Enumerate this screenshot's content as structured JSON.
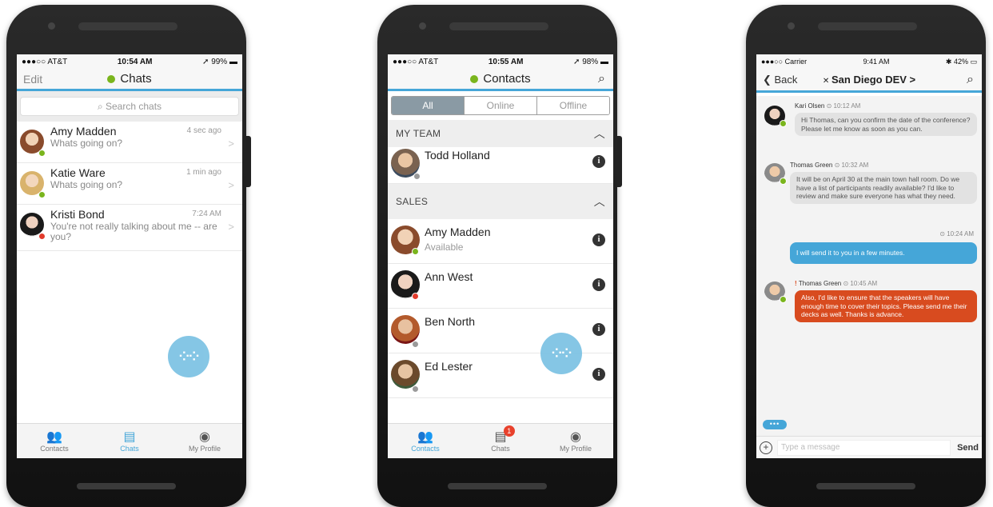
{
  "colors": {
    "accent": "#45a6d8",
    "online": "#7ab51d",
    "busy": "#e23b2c",
    "offline": "#9a9a9a",
    "urgent": "#d84b1f"
  },
  "phone1": {
    "status": {
      "carrier": "●●●○○ AT&T",
      "time": "10:54 AM",
      "battery": "99%"
    },
    "nav": {
      "left": "Edit",
      "title": "Chats"
    },
    "search_placeholder": "Search chats",
    "chats": [
      {
        "name": "Amy Madden",
        "preview": "Whats going on?",
        "time": "4 sec ago"
      },
      {
        "name": "Katie Ware",
        "preview": "Whats going on?",
        "time": "1 min ago"
      },
      {
        "name": "Kristi Bond",
        "preview": "You're not really talking about me -- are you?",
        "time": "7:24 AM"
      }
    ],
    "tabs": [
      {
        "label": "Contacts",
        "icon": "contacts-icon"
      },
      {
        "label": "Chats",
        "icon": "chats-icon"
      },
      {
        "label": "My Profile",
        "icon": "profile-icon"
      }
    ]
  },
  "phone2": {
    "status": {
      "carrier": "●●●○○ AT&T",
      "time": "10:55 AM",
      "battery": "98%"
    },
    "nav": {
      "title": "Contacts"
    },
    "segments": [
      "All",
      "Online",
      "Offline"
    ],
    "sections": [
      {
        "title": "MY TEAM",
        "contacts": [
          {
            "name": "Todd Holland",
            "status": ""
          }
        ]
      },
      {
        "title": "SALES",
        "contacts": [
          {
            "name": "Amy Madden",
            "status": "Available"
          },
          {
            "name": "Ann West",
            "status": ""
          },
          {
            "name": "Ben North",
            "status": ""
          },
          {
            "name": "Ed Lester",
            "status": ""
          }
        ]
      }
    ],
    "tabs": [
      {
        "label": "Contacts",
        "icon": "contacts-icon"
      },
      {
        "label": "Chats",
        "icon": "chats-icon",
        "badge": "1"
      },
      {
        "label": "My Profile",
        "icon": "profile-icon"
      }
    ]
  },
  "phone3": {
    "status": {
      "carrier": "●●●○○ Carrier",
      "time": "9:41 AM",
      "battery": "42%"
    },
    "nav": {
      "back": "Back",
      "title": "San Diego DEV >"
    },
    "messages": [
      {
        "sender": "Kari Olsen",
        "time": "10:12 AM",
        "text": "Hi Thomas, can you confirm the date of the conference? Please let me know as soon as you can."
      },
      {
        "sender": "Thomas Green",
        "time": "10:32 AM",
        "text": "It will be on April 30 at the main town hall room. Do we have a list of participants readily available? I'd like to review and make sure everyone has what they need."
      },
      {
        "sender": "",
        "time": "10:24 AM",
        "text": "I will send it to you in a few minutes."
      },
      {
        "sender": "Thomas Green",
        "time": "10:45 AM",
        "text": "Also, I'd like to ensure that the speakers will have enough time to cover their topics. Please send me their decks as well. Thanks is advance."
      }
    ],
    "composer": {
      "placeholder": "Type a message",
      "send": "Send"
    }
  }
}
